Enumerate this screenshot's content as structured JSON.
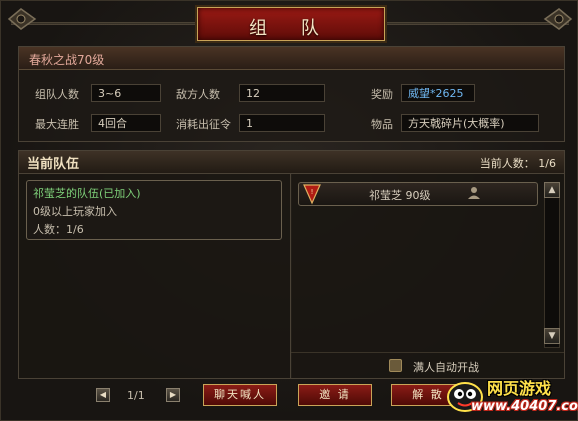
{
  "window": {
    "title": "组 队"
  },
  "battle": {
    "name": "春秋之战70级",
    "team_size_label": "组队人数",
    "team_size_value": "3~6",
    "enemy_count_label": "敌方人数",
    "enemy_count_value": "12",
    "reward_label": "奖励",
    "reward_value": "威望*2625",
    "max_streak_label": "最大连胜",
    "max_streak_value": "4回合",
    "cost_label": "消耗出征令",
    "cost_value": "1",
    "item_label": "物品",
    "item_value": "方天戟碎片(大概率)"
  },
  "current_team": {
    "title": "当前队伍",
    "count_label": "当前人数：",
    "count_value": "1/6"
  },
  "team_list": [
    {
      "name": "祁莹芝的队伍(已加入)",
      "requirement": "0级以上玩家加入",
      "members": "人数：1/6"
    }
  ],
  "members": [
    {
      "name": "祁莹芝",
      "level": "90级"
    }
  ],
  "auto_start_label": "满人自动开战",
  "pager": {
    "text": "1/1"
  },
  "buttons": {
    "chat": "聊天喊人",
    "invite": "邀 请",
    "disband": "解 散"
  },
  "watermark": {
    "main": "网页游戏",
    "sub": "www.40407.com"
  },
  "colors": {
    "title_red": "#9a1a14",
    "gold_border": "#c9a458",
    "reward_blue": "#6fb6f0",
    "team_green": "#7fd27a"
  }
}
